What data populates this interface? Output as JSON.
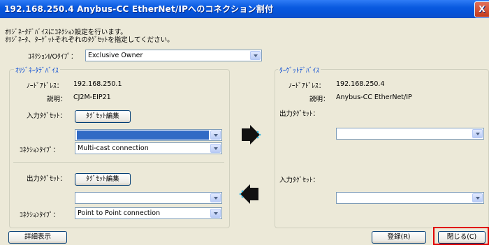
{
  "window": {
    "title": "192.168.250.4 Anybus-CC EtherNet/IPへのコネクション割付",
    "close_label": "X"
  },
  "description": {
    "line1": "ｵﾘｼﾞﾈｰﾀﾃﾞﾊﾞｲｽにｺﾈｸｼｮﾝ設定を行います。",
    "line2": "ｵﾘｼﾞﾈｰﾀ、ﾀｰｹﾞｯﾄそれぞれのﾀｸﾞｾｯﾄを指定してください。"
  },
  "connection_io_type": {
    "label": "ｺﾈｸｼｮﾝI/Oﾀｲﾌﾟ：",
    "value": "Exclusive Owner"
  },
  "originator": {
    "title": "ｵﾘｼﾞﾈｰﾀﾃﾞﾊﾞｲｽ",
    "node_address_label": "ﾉｰﾄﾞｱﾄﾞﾚｽ：",
    "node_address": "192.168.250.1",
    "description_label": "説明：",
    "description": "CJ2M-EIP21",
    "input_tagset_label": "入力ﾀｸﾞｾｯﾄ：",
    "input_tagset_value": "",
    "edit_button": "ﾀｸﾞｾｯﾄ編集",
    "input_connection_type_label": "ｺﾈｸｼｮﾝﾀｲﾌﾟ：",
    "input_connection_type": "Multi-cast connection",
    "output_tagset_label": "出力ﾀｸﾞｾｯﾄ：",
    "output_edit_button": "ﾀｸﾞｾｯﾄ編集",
    "output_tagset_value": "",
    "output_connection_type_label": "ｺﾈｸｼｮﾝﾀｲﾌﾟ：",
    "output_connection_type": "Point to Point connection"
  },
  "target": {
    "title": "ﾀｰｹﾞｯﾄﾃﾞﾊﾞｲｽ",
    "node_address_label": "ﾉｰﾄﾞｱﾄﾞﾚｽ：",
    "node_address": "192.168.250.4",
    "description_label": "説明：",
    "description": "Anybus-CC EtherNet/IP",
    "output_tagset_label": "出力ﾀｸﾞｾｯﾄ：",
    "output_tagset_value": "",
    "input_tagset_label": "入力ﾀｸﾞｾｯﾄ：",
    "input_tagset_value": ""
  },
  "footer": {
    "details_button": "詳細表示",
    "register_button": "登録(R)",
    "close_button": "閉じる(C)"
  },
  "colors": {
    "title_bar": "#0a5ae0",
    "group_title": "#0046d5",
    "selection": "#316ac5",
    "highlight_box": "#e00000"
  }
}
